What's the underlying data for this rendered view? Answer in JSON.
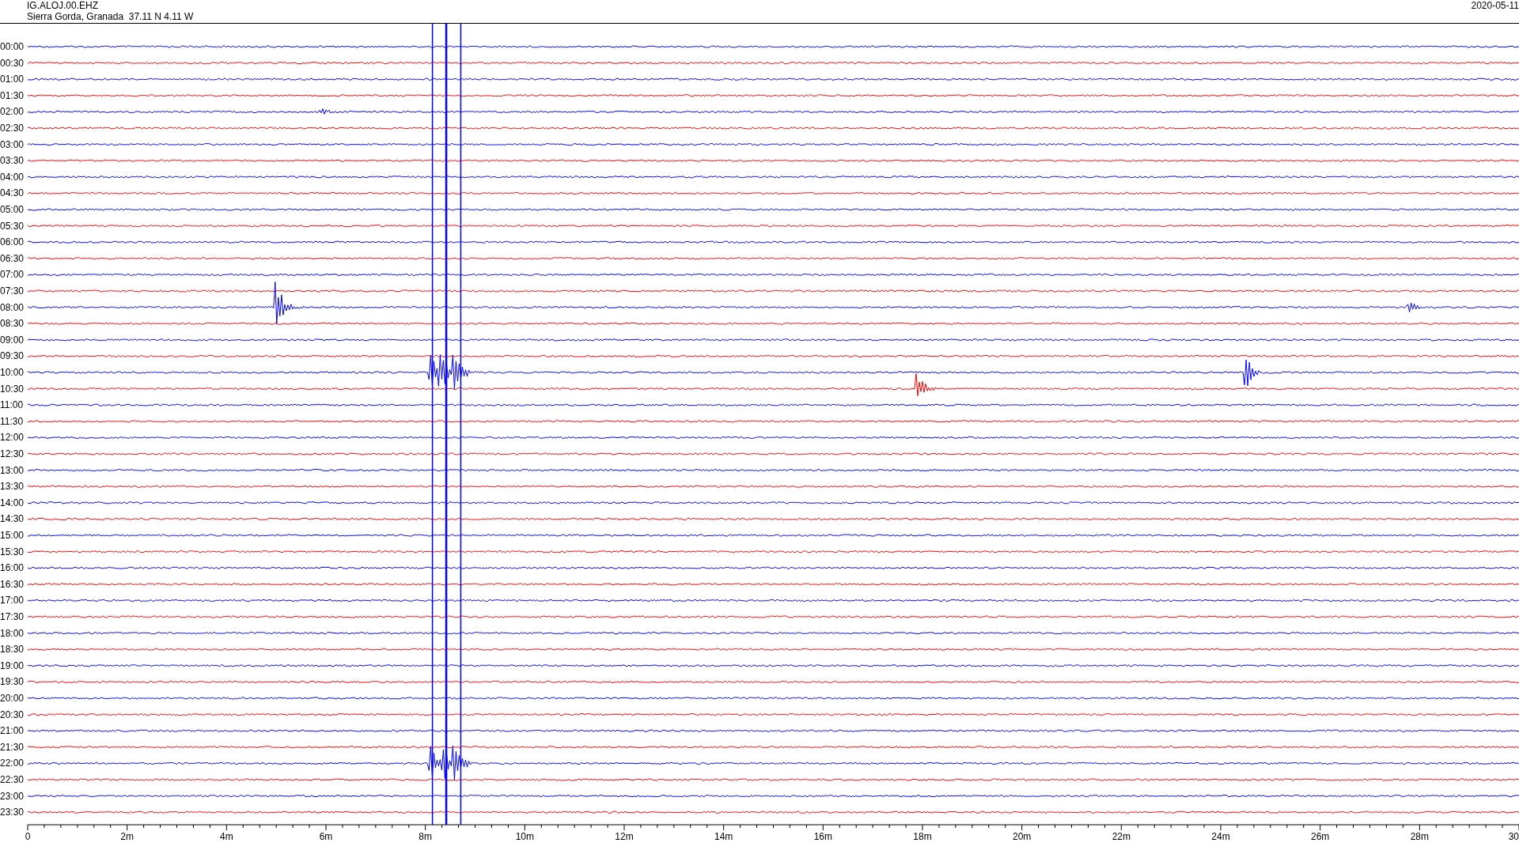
{
  "header": {
    "station": "IG.ALOJ.00.EHZ",
    "location": "Sierra Gorda, Granada  37.11 N 4.11 W",
    "date": "2020-05-11"
  },
  "rows": [
    {
      "time": "00:00",
      "color": "#0000ff"
    },
    {
      "time": "00:30",
      "color": "#ff0000"
    },
    {
      "time": "01:00",
      "color": "#0000ff"
    },
    {
      "time": "01:30",
      "color": "#ff0000"
    },
    {
      "time": "02:00",
      "color": "#0000ff"
    },
    {
      "time": "02:30",
      "color": "#ff0000"
    },
    {
      "time": "03:00",
      "color": "#0000ff"
    },
    {
      "time": "03:30",
      "color": "#ff0000"
    },
    {
      "time": "04:00",
      "color": "#0000ff"
    },
    {
      "time": "04:30",
      "color": "#ff0000"
    },
    {
      "time": "05:00",
      "color": "#0000ff"
    },
    {
      "time": "05:30",
      "color": "#ff0000"
    },
    {
      "time": "06:00",
      "color": "#0000ff"
    },
    {
      "time": "06:30",
      "color": "#ff0000"
    },
    {
      "time": "07:00",
      "color": "#0000ff"
    },
    {
      "time": "07:30",
      "color": "#ff0000"
    },
    {
      "time": "08:00",
      "color": "#0000ff"
    },
    {
      "time": "08:30",
      "color": "#ff0000"
    },
    {
      "time": "09:00",
      "color": "#0000ff"
    },
    {
      "time": "09:30",
      "color": "#ff0000"
    },
    {
      "time": "10:00",
      "color": "#0000ff"
    },
    {
      "time": "10:30",
      "color": "#ff0000"
    },
    {
      "time": "11:00",
      "color": "#0000ff"
    },
    {
      "time": "11:30",
      "color": "#ff0000"
    },
    {
      "time": "12:00",
      "color": "#0000ff"
    },
    {
      "time": "12:30",
      "color": "#ff0000"
    },
    {
      "time": "13:00",
      "color": "#0000ff"
    },
    {
      "time": "13:30",
      "color": "#ff0000"
    },
    {
      "time": "14:00",
      "color": "#0000ff"
    },
    {
      "time": "14:30",
      "color": "#ff0000"
    },
    {
      "time": "15:00",
      "color": "#0000ff"
    },
    {
      "time": "15:30",
      "color": "#ff0000"
    },
    {
      "time": "16:00",
      "color": "#0000ff"
    },
    {
      "time": "16:30",
      "color": "#ff0000"
    },
    {
      "time": "17:00",
      "color": "#0000ff"
    },
    {
      "time": "17:30",
      "color": "#ff0000"
    },
    {
      "time": "18:00",
      "color": "#0000ff"
    },
    {
      "time": "18:30",
      "color": "#ff0000"
    },
    {
      "time": "19:00",
      "color": "#0000ff"
    },
    {
      "time": "19:30",
      "color": "#ff0000"
    },
    {
      "time": "20:00",
      "color": "#0000ff"
    },
    {
      "time": "20:30",
      "color": "#ff0000"
    },
    {
      "time": "21:00",
      "color": "#0000ff"
    },
    {
      "time": "21:30",
      "color": "#ff0000"
    },
    {
      "time": "22:00",
      "color": "#0000ff"
    },
    {
      "time": "22:30",
      "color": "#ff0000"
    },
    {
      "time": "23:00",
      "color": "#0000ff"
    },
    {
      "time": "23:30",
      "color": "#ff0000"
    }
  ],
  "x_axis": {
    "labels": [
      "0",
      "2m",
      "4m",
      "6m",
      "8m",
      "10m",
      "12m",
      "14m",
      "16m",
      "18m",
      "20m",
      "22m",
      "24m",
      "26m",
      "28m",
      "30"
    ]
  }
}
